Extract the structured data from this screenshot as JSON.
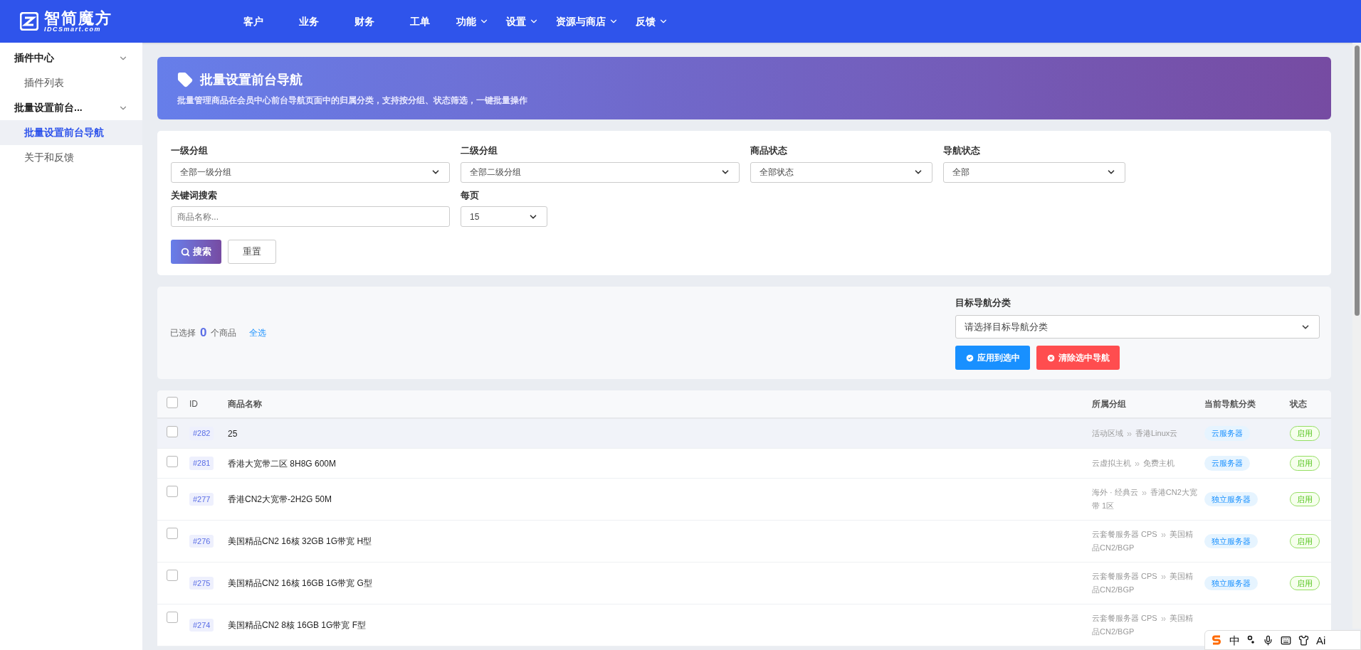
{
  "brand": {
    "name": "智简魔方",
    "subtitle": "IDCSmart.com"
  },
  "nav": [
    {
      "label": "客户",
      "dropdown": false
    },
    {
      "label": "业务",
      "dropdown": false
    },
    {
      "label": "财务",
      "dropdown": false
    },
    {
      "label": "工单",
      "dropdown": false
    },
    {
      "label": "功能",
      "dropdown": true
    },
    {
      "label": "设置",
      "dropdown": true
    },
    {
      "label": "资源与商店",
      "dropdown": true
    },
    {
      "label": "反馈",
      "dropdown": true
    }
  ],
  "sidebar": [
    {
      "label": "插件中心",
      "expanded": true,
      "children": [
        {
          "label": "插件列表",
          "selected": false
        }
      ]
    },
    {
      "label": "批量设置前台...",
      "expanded": true,
      "children": [
        {
          "label": "批量设置前台导航",
          "selected": true
        },
        {
          "label": "关于和反馈",
          "selected": false
        }
      ]
    }
  ],
  "banner": {
    "title": "批量设置前台导航",
    "description": "批量管理商品在会员中心前台导航页面中的归属分类，支持按分组、状态筛选，一键批量操作"
  },
  "filters": [
    {
      "label": "一级分组",
      "kind": "select",
      "value": "全部一级分组"
    },
    {
      "label": "二级分组",
      "kind": "select",
      "value": "全部二级分组"
    },
    {
      "label": "商品状态",
      "kind": "select",
      "value": "全部状态"
    },
    {
      "label": "导航状态",
      "kind": "select",
      "value": "全部"
    },
    {
      "label": "关键词搜索",
      "kind": "text",
      "placeholder": "商品名称..."
    },
    {
      "label": "每页",
      "kind": "select",
      "value": "15"
    }
  ],
  "search_button": "搜索",
  "reset_button": "重置",
  "selection": {
    "prefix": "已选择",
    "count": "0",
    "suffix": "个商品",
    "select_all": "全选"
  },
  "target": {
    "label": "目标导航分类",
    "placeholder": "请选择目标导航分类",
    "apply_button": "应用到选中",
    "clear_button": "清除选中导航"
  },
  "table": {
    "select_all_checked": false,
    "columns": [
      "ID",
      "商品名称",
      "所属分组",
      "当前导航分类",
      "状态"
    ],
    "rows": [
      {
        "checked": false,
        "highlighted": true,
        "id": "#282",
        "name": "25",
        "group": [
          "活动区域",
          "香港Linux云"
        ],
        "nav": "云服务器",
        "status": "启用"
      },
      {
        "checked": false,
        "highlighted": false,
        "id": "#281",
        "name": "香港大宽带二区 8H8G 600M",
        "group": [
          "云虚拟主机",
          "免费主机"
        ],
        "nav": "云服务器",
        "status": "启用"
      },
      {
        "checked": false,
        "highlighted": false,
        "id": "#277",
        "name": "香港CN2大宽带-2H2G 50M",
        "group": [
          "海外 · 经典云",
          "香港CN2大宽带 1区"
        ],
        "nav": "独立服务器",
        "status": "启用"
      },
      {
        "checked": false,
        "highlighted": false,
        "id": "#276",
        "name": "美国精品CN2 16核 32GB 1G带宽 H型",
        "group": [
          "云套餐服务器 CPS",
          "美国精品CN2/BGP"
        ],
        "nav": "独立服务器",
        "status": "启用"
      },
      {
        "checked": false,
        "highlighted": false,
        "id": "#275",
        "name": "美国精品CN2 16核 16GB 1G带宽 G型",
        "group": [
          "云套餐服务器 CPS",
          "美国精品CN2/BGP"
        ],
        "nav": "独立服务器",
        "status": "启用"
      },
      {
        "checked": false,
        "highlighted": false,
        "id": "#274",
        "name": "美国精品CN2 8核 16GB 1G带宽 F型",
        "group": [
          "云套餐服务器 CPS",
          "美国精品CN2/BGP"
        ]
      }
    ]
  },
  "ime_toolbar": {
    "mode": "中",
    "assistant": "Ai"
  }
}
